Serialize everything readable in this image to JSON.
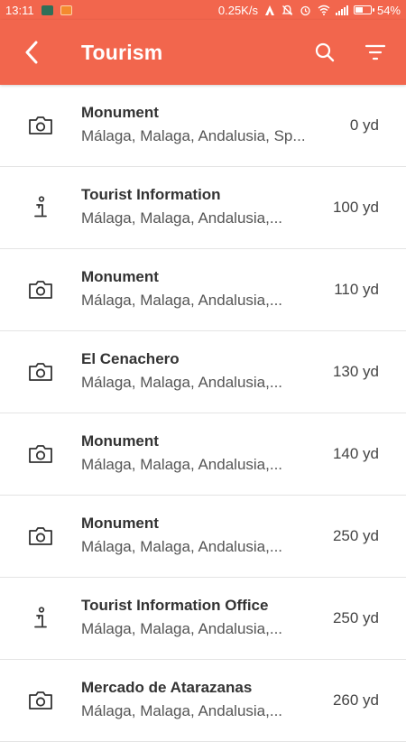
{
  "status_bar": {
    "time": "13:11",
    "network_speed": "0.25K/s",
    "battery_percent": "54%",
    "battery_level": 0.54,
    "icons": [
      "notif-green-icon",
      "notif-orange-icon",
      "data-saver-icon",
      "silent-bell-icon",
      "alarm-icon",
      "wifi-icon",
      "signal-icon",
      "battery-icon"
    ]
  },
  "app_bar": {
    "title": "Tourism",
    "back_icon": "back-chevron-icon",
    "search_icon": "search-icon",
    "filter_icon": "filter-icon",
    "color": "#f2664d"
  },
  "items": [
    {
      "icon": "camera-icon",
      "title": "Monument",
      "subtitle": "Málaga, Malaga, Andalusia, Sp...",
      "distance": "0 yd"
    },
    {
      "icon": "info-icon",
      "title": "Tourist Information",
      "subtitle": "Málaga, Malaga, Andalusia,...",
      "distance": "100 yd"
    },
    {
      "icon": "camera-icon",
      "title": "Monument",
      "subtitle": "Málaga, Malaga, Andalusia,...",
      "distance": "110 yd"
    },
    {
      "icon": "camera-icon",
      "title": "El Cenachero",
      "subtitle": "Málaga, Malaga, Andalusia,...",
      "distance": "130 yd"
    },
    {
      "icon": "camera-icon",
      "title": "Monument",
      "subtitle": "Málaga, Malaga, Andalusia,...",
      "distance": "140 yd"
    },
    {
      "icon": "camera-icon",
      "title": "Monument",
      "subtitle": "Málaga, Malaga, Andalusia,...",
      "distance": "250 yd"
    },
    {
      "icon": "info-icon",
      "title": "Tourist Information Office",
      "subtitle": "Málaga, Malaga, Andalusia,...",
      "distance": "250 yd"
    },
    {
      "icon": "camera-icon",
      "title": "Mercado de Atarazanas",
      "subtitle": "Málaga, Malaga, Andalusia,...",
      "distance": "260 yd"
    }
  ]
}
